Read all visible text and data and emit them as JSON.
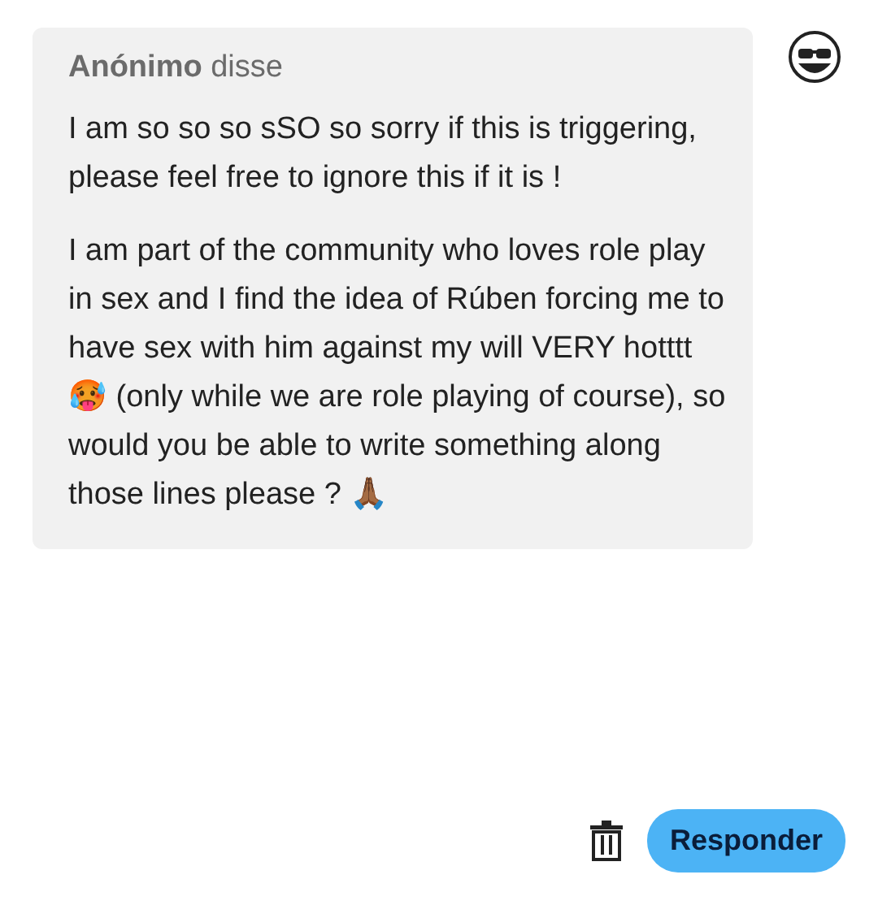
{
  "ask": {
    "header": "**Anónimo** disse",
    "paragraphs": [
      "I am so so so sSO so sorry if this is triggering, please feel free to ignore this if it is !",
      "I am part of the community who loves role play in sex and I find the idea of Rúben forcing me to have sex with him against my will VERY hotttt🥵 (only while we are role playing of course), so would you be able to write something along those lines please ? 🙏🏾"
    ]
  },
  "actions": {
    "reply_button": "Responder"
  }
}
